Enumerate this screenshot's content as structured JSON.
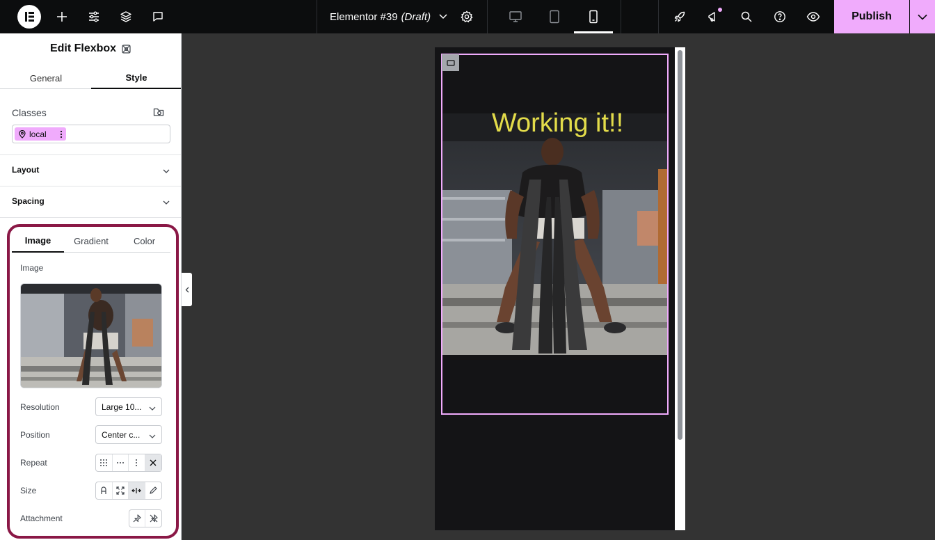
{
  "topbar": {
    "doc_name": "Elementor #39",
    "doc_status": "(Draft)",
    "publish_label": "Publish",
    "icons": [
      "elementor-logo-icon",
      "add-icon",
      "site-settings-icon",
      "structure-icon",
      "comments-icon",
      "document-settings-icon",
      "desktop-icon",
      "tablet-icon",
      "mobile-icon",
      "launchpad-icon",
      "whats-new-icon",
      "finder-icon",
      "help-icon",
      "preview-icon",
      "publish-options-icon"
    ],
    "accent_color": "#f0abfc",
    "active_device": "mobile"
  },
  "panel": {
    "title": "Edit Flexbox",
    "tabs": [
      {
        "label": "General",
        "active": false
      },
      {
        "label": "Style",
        "active": true
      }
    ],
    "classes": {
      "label": "Classes",
      "chip_label": "local"
    },
    "sections": [
      {
        "label": "Layout"
      },
      {
        "label": "Spacing"
      }
    ],
    "background": {
      "tabs": [
        {
          "label": "Image",
          "active": true
        },
        {
          "label": "Gradient",
          "active": false
        },
        {
          "label": "Color",
          "active": false
        }
      ],
      "image_label": "Image",
      "resolution": {
        "label": "Resolution",
        "value": "Large 10..."
      },
      "position": {
        "label": "Position",
        "value": "Center c..."
      },
      "repeat": {
        "label": "Repeat",
        "selected": "no-repeat"
      },
      "size": {
        "label": "Size",
        "selected": "stretch"
      },
      "attachment": {
        "label": "Attachment"
      }
    },
    "highlight_color": "#8a1846"
  },
  "canvas": {
    "heading": "Working it!!",
    "heading_color": "#e3dc4a",
    "outline_color": "#f0abfc"
  }
}
